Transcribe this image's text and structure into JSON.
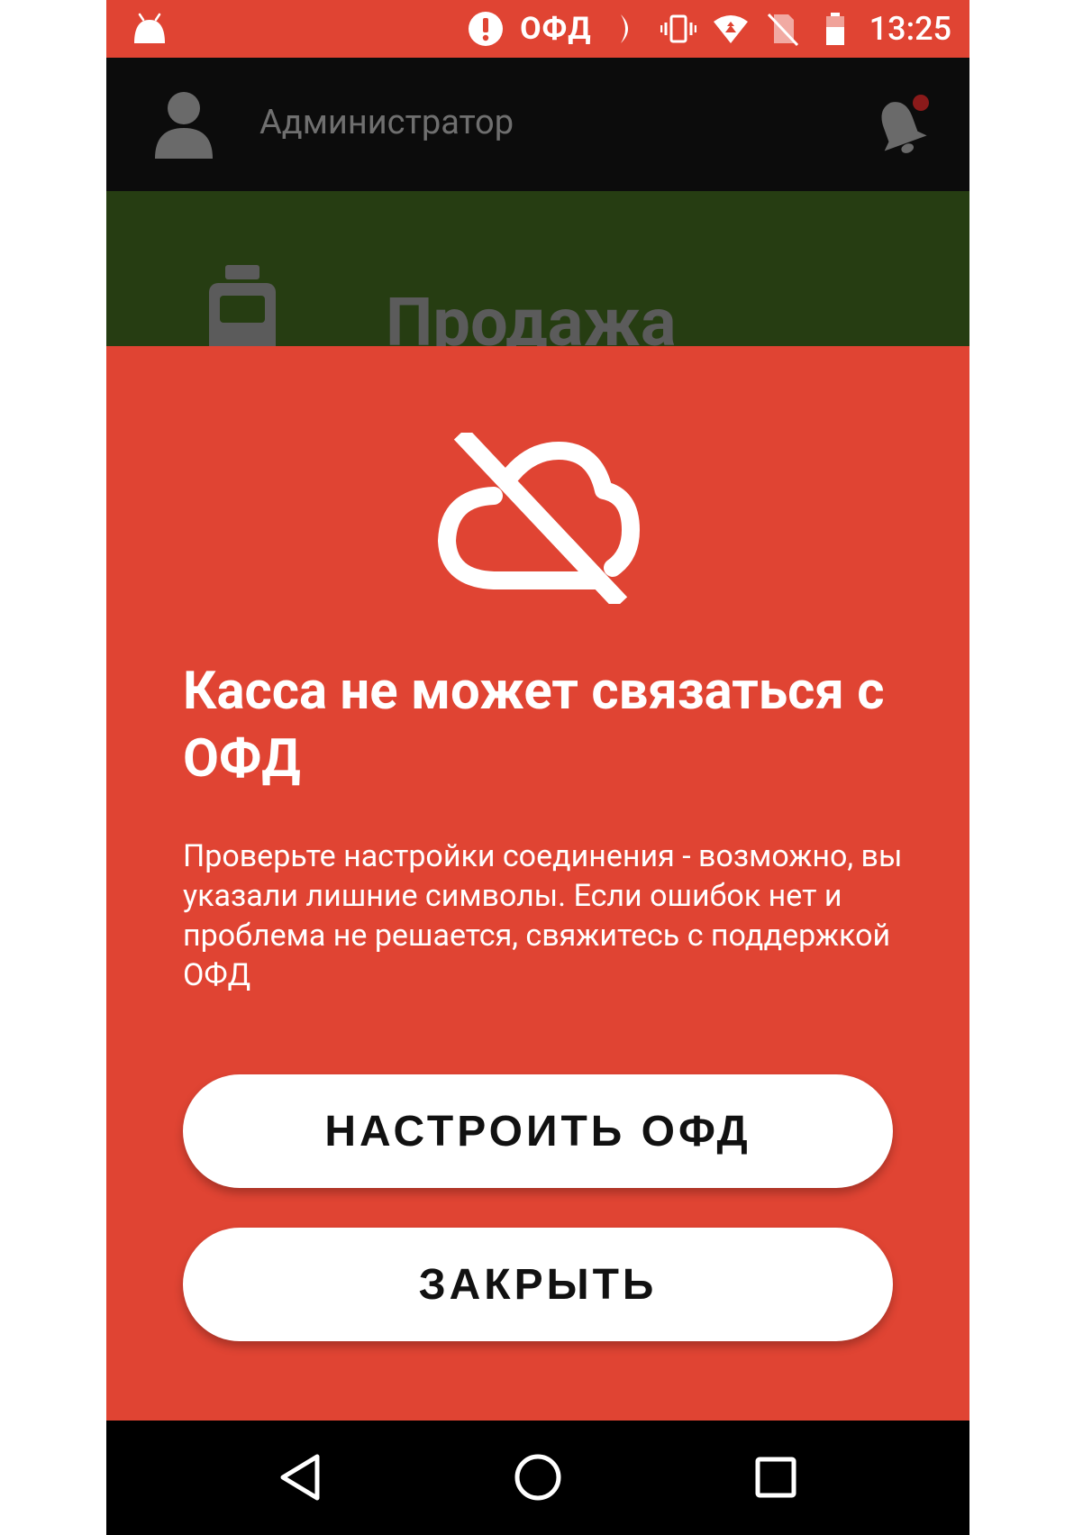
{
  "status_bar": {
    "operator": "ОФД",
    "time": "13:25",
    "color": "#e04433"
  },
  "header": {
    "user_name": "Администратор"
  },
  "tile": {
    "label": "Продажа",
    "color": "#263d12"
  },
  "dialog": {
    "title": "Касса не может связаться с ОФД",
    "message": "Проверьте настройки соединения - возможно, вы указали лишние символы. Если ошибок нет и проблема не решается, свяжитесь с поддержкой ОФД",
    "primary_button": "НАСТРОИТЬ ОФД",
    "secondary_button": "ЗАКРЫТЬ",
    "background_color": "#e04433"
  },
  "icons": {
    "status": [
      "android-icon",
      "alert-icon",
      "moon-icon",
      "vibrate-icon",
      "wifi-icon",
      "no-sim-icon",
      "battery-icon"
    ],
    "header": [
      "user-icon",
      "bell-icon"
    ],
    "dialog": "cloud-off-icon",
    "nav": [
      "back-icon",
      "home-icon",
      "recent-apps-icon"
    ]
  }
}
